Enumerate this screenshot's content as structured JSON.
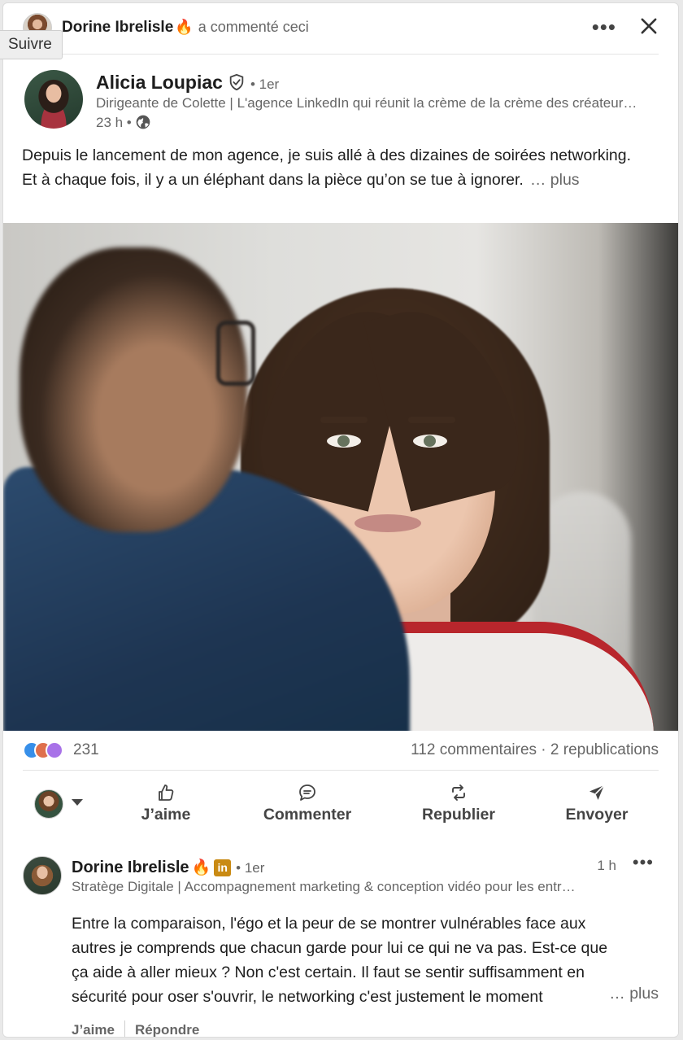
{
  "tooltip": {
    "text": "Suivre"
  },
  "activity": {
    "actor_name": "Dorine Ibrelisle",
    "actor_emoji": "🔥",
    "verb": "a commenté ceci",
    "more_icon": "ellipsis-icon",
    "close_icon": "close-icon"
  },
  "author": {
    "name": "Alicia Loupiac",
    "verified_icon": "shield-check-icon",
    "degree": "• 1er",
    "headline": "Dirigeante de Colette | L'agence LinkedIn qui réunit la crème de la crème des créateurs et créatrices de contenu",
    "time": "23 h •",
    "visibility_icon": "globe-icon"
  },
  "post": {
    "text": "Depuis le lancement de mon agence, je suis allé à des dizaines de soirées networking. Et à chaque fois, il y a un éléphant dans la pièce qu’on se tue à ignorer.",
    "see_more": "… plus"
  },
  "social": {
    "reaction_count": "231",
    "comments": "112 commentaires",
    "separator": "·",
    "reposts": "2 republications",
    "reaction_icons": [
      "like-icon",
      "love-icon",
      "support-icon"
    ],
    "colors": {
      "like": "#378fe9",
      "love": "#df704d",
      "support": "#a872e8"
    }
  },
  "actions": {
    "like": "J’aime",
    "comment": "Commenter",
    "repost": "Republier",
    "send": "Envoyer"
  },
  "comment": {
    "name": "Dorine Ibrelisle",
    "emoji": "🔥",
    "badge": "in",
    "degree": "• 1er",
    "time": "1 h",
    "headline": "Stratège Digitale | Accompagnement marketing & conception vidéo pour les entrepreneurs",
    "text": "Entre la comparaison, l'égo et la peur de se montrer vulnérables face aux autres je comprends que chacun garde pour lui ce qui ne va pas. Est-ce que ça aide à aller mieux ? Non c'est certain. Il faut se sentir suffisamment en sécurité pour oser s'ouvrir, le networking c'est justement le moment",
    "see_more": "… plus",
    "like": "J’aime",
    "reply": "Répondre"
  }
}
